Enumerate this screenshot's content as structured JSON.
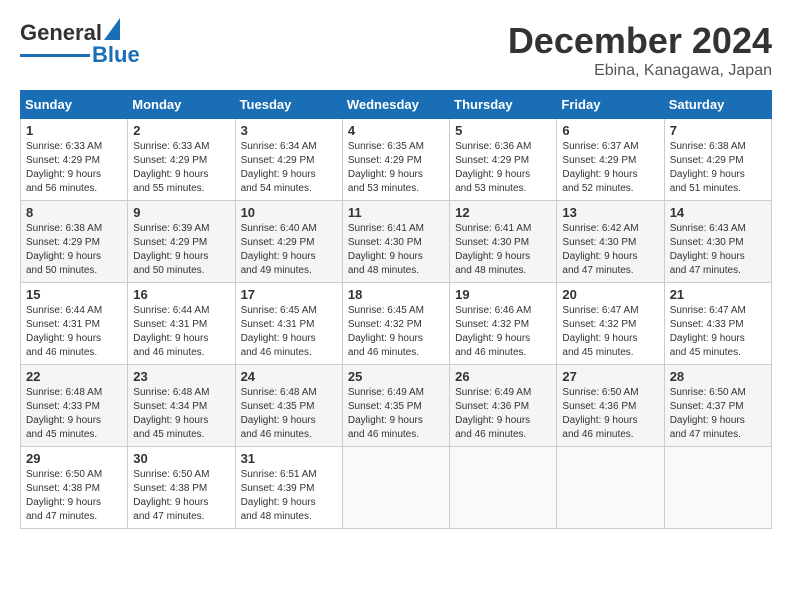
{
  "header": {
    "logo_general": "General",
    "logo_blue": "Blue",
    "month": "December 2024",
    "location": "Ebina, Kanagawa, Japan"
  },
  "days_of_week": [
    "Sunday",
    "Monday",
    "Tuesday",
    "Wednesday",
    "Thursday",
    "Friday",
    "Saturday"
  ],
  "weeks": [
    [
      {
        "day": "1",
        "sunrise": "6:33 AM",
        "sunset": "4:29 PM",
        "daylight_hours": "9 hours",
        "daylight_minutes": "and 56 minutes."
      },
      {
        "day": "2",
        "sunrise": "6:33 AM",
        "sunset": "4:29 PM",
        "daylight_hours": "9 hours",
        "daylight_minutes": "and 55 minutes."
      },
      {
        "day": "3",
        "sunrise": "6:34 AM",
        "sunset": "4:29 PM",
        "daylight_hours": "9 hours",
        "daylight_minutes": "and 54 minutes."
      },
      {
        "day": "4",
        "sunrise": "6:35 AM",
        "sunset": "4:29 PM",
        "daylight_hours": "9 hours",
        "daylight_minutes": "and 53 minutes."
      },
      {
        "day": "5",
        "sunrise": "6:36 AM",
        "sunset": "4:29 PM",
        "daylight_hours": "9 hours",
        "daylight_minutes": "and 53 minutes."
      },
      {
        "day": "6",
        "sunrise": "6:37 AM",
        "sunset": "4:29 PM",
        "daylight_hours": "9 hours",
        "daylight_minutes": "and 52 minutes."
      },
      {
        "day": "7",
        "sunrise": "6:38 AM",
        "sunset": "4:29 PM",
        "daylight_hours": "9 hours",
        "daylight_minutes": "and 51 minutes."
      }
    ],
    [
      {
        "day": "8",
        "sunrise": "6:38 AM",
        "sunset": "4:29 PM",
        "daylight_hours": "9 hours",
        "daylight_minutes": "and 50 minutes."
      },
      {
        "day": "9",
        "sunrise": "6:39 AM",
        "sunset": "4:29 PM",
        "daylight_hours": "9 hours",
        "daylight_minutes": "and 50 minutes."
      },
      {
        "day": "10",
        "sunrise": "6:40 AM",
        "sunset": "4:29 PM",
        "daylight_hours": "9 hours",
        "daylight_minutes": "and 49 minutes."
      },
      {
        "day": "11",
        "sunrise": "6:41 AM",
        "sunset": "4:30 PM",
        "daylight_hours": "9 hours",
        "daylight_minutes": "and 48 minutes."
      },
      {
        "day": "12",
        "sunrise": "6:41 AM",
        "sunset": "4:30 PM",
        "daylight_hours": "9 hours",
        "daylight_minutes": "and 48 minutes."
      },
      {
        "day": "13",
        "sunrise": "6:42 AM",
        "sunset": "4:30 PM",
        "daylight_hours": "9 hours",
        "daylight_minutes": "and 47 minutes."
      },
      {
        "day": "14",
        "sunrise": "6:43 AM",
        "sunset": "4:30 PM",
        "daylight_hours": "9 hours",
        "daylight_minutes": "and 47 minutes."
      }
    ],
    [
      {
        "day": "15",
        "sunrise": "6:44 AM",
        "sunset": "4:31 PM",
        "daylight_hours": "9 hours",
        "daylight_minutes": "and 46 minutes."
      },
      {
        "day": "16",
        "sunrise": "6:44 AM",
        "sunset": "4:31 PM",
        "daylight_hours": "9 hours",
        "daylight_minutes": "and 46 minutes."
      },
      {
        "day": "17",
        "sunrise": "6:45 AM",
        "sunset": "4:31 PM",
        "daylight_hours": "9 hours",
        "daylight_minutes": "and 46 minutes."
      },
      {
        "day": "18",
        "sunrise": "6:45 AM",
        "sunset": "4:32 PM",
        "daylight_hours": "9 hours",
        "daylight_minutes": "and 46 minutes."
      },
      {
        "day": "19",
        "sunrise": "6:46 AM",
        "sunset": "4:32 PM",
        "daylight_hours": "9 hours",
        "daylight_minutes": "and 46 minutes."
      },
      {
        "day": "20",
        "sunrise": "6:47 AM",
        "sunset": "4:32 PM",
        "daylight_hours": "9 hours",
        "daylight_minutes": "and 45 minutes."
      },
      {
        "day": "21",
        "sunrise": "6:47 AM",
        "sunset": "4:33 PM",
        "daylight_hours": "9 hours",
        "daylight_minutes": "and 45 minutes."
      }
    ],
    [
      {
        "day": "22",
        "sunrise": "6:48 AM",
        "sunset": "4:33 PM",
        "daylight_hours": "9 hours",
        "daylight_minutes": "and 45 minutes."
      },
      {
        "day": "23",
        "sunrise": "6:48 AM",
        "sunset": "4:34 PM",
        "daylight_hours": "9 hours",
        "daylight_minutes": "and 45 minutes."
      },
      {
        "day": "24",
        "sunrise": "6:48 AM",
        "sunset": "4:35 PM",
        "daylight_hours": "9 hours",
        "daylight_minutes": "and 46 minutes."
      },
      {
        "day": "25",
        "sunrise": "6:49 AM",
        "sunset": "4:35 PM",
        "daylight_hours": "9 hours",
        "daylight_minutes": "and 46 minutes."
      },
      {
        "day": "26",
        "sunrise": "6:49 AM",
        "sunset": "4:36 PM",
        "daylight_hours": "9 hours",
        "daylight_minutes": "and 46 minutes."
      },
      {
        "day": "27",
        "sunrise": "6:50 AM",
        "sunset": "4:36 PM",
        "daylight_hours": "9 hours",
        "daylight_minutes": "and 46 minutes."
      },
      {
        "day": "28",
        "sunrise": "6:50 AM",
        "sunset": "4:37 PM",
        "daylight_hours": "9 hours",
        "daylight_minutes": "and 47 minutes."
      }
    ],
    [
      {
        "day": "29",
        "sunrise": "6:50 AM",
        "sunset": "4:38 PM",
        "daylight_hours": "9 hours",
        "daylight_minutes": "and 47 minutes."
      },
      {
        "day": "30",
        "sunrise": "6:50 AM",
        "sunset": "4:38 PM",
        "daylight_hours": "9 hours",
        "daylight_minutes": "and 47 minutes."
      },
      {
        "day": "31",
        "sunrise": "6:51 AM",
        "sunset": "4:39 PM",
        "daylight_hours": "9 hours",
        "daylight_minutes": "and 48 minutes."
      },
      null,
      null,
      null,
      null
    ]
  ]
}
